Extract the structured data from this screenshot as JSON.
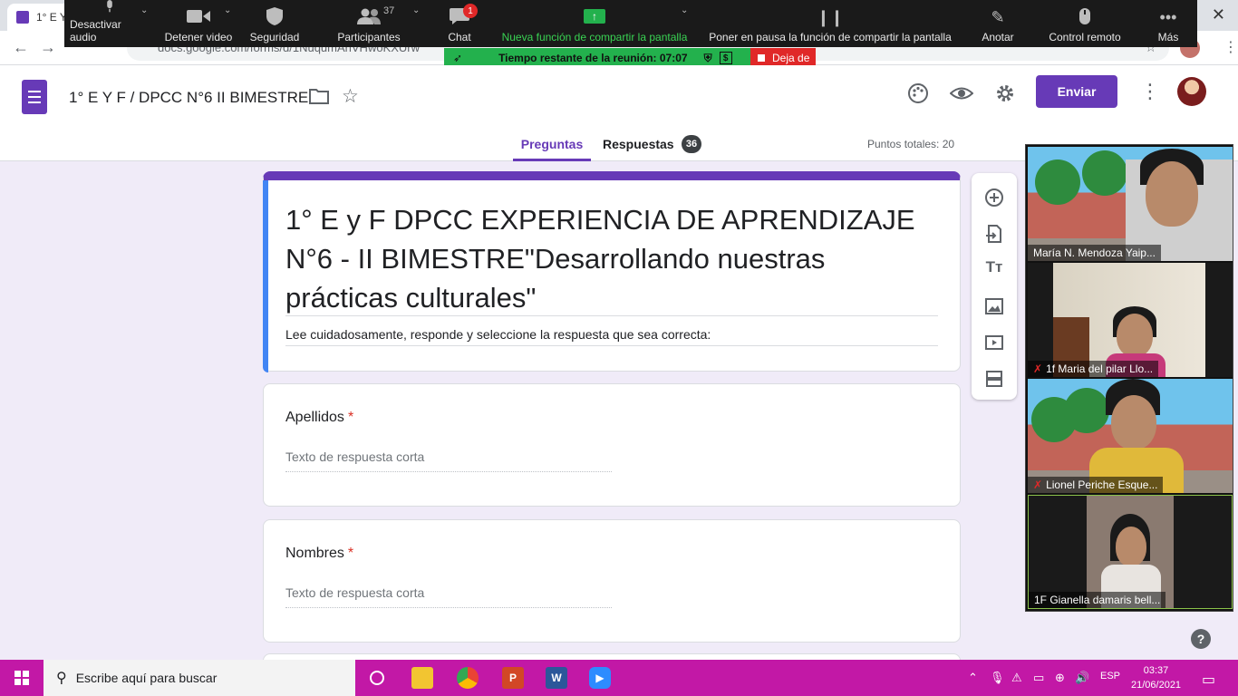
{
  "browser": {
    "tab_title": "1° E Y",
    "url": "docs.google.com/forms/d/1NuqumAhVHwoKXUrw"
  },
  "zoom": {
    "items": [
      {
        "label": "Desactivar audio",
        "icon": "microphone-icon"
      },
      {
        "label": "Detener video",
        "icon": "video-camera-icon"
      },
      {
        "label": "Seguridad",
        "icon": "shield-icon"
      },
      {
        "label": "Participantes",
        "icon": "participants-icon",
        "count": "37"
      },
      {
        "label": "Chat",
        "icon": "chat-icon",
        "badge": "1"
      },
      {
        "label": "Nueva función de compartir la pantalla",
        "icon": "share-screen-icon"
      },
      {
        "label": "Poner en pausa la función de compartir la pantalla",
        "icon": "pause-icon"
      },
      {
        "label": "Anotar",
        "icon": "pencil-icon"
      },
      {
        "label": "Control remoto",
        "icon": "mouse-icon"
      },
      {
        "label": "Más",
        "icon": "more-icon"
      }
    ],
    "timer": "Tiempo restante de la reunión: 07:07",
    "stop_share": "Deja de"
  },
  "forms": {
    "doc_title": "1° E  Y F  / DPCC N°6 II BIMESTRE",
    "send_label": "Enviar",
    "tab_questions": "Preguntas",
    "tab_responses": "Respuestas",
    "responses_count": "36",
    "total_points": "Puntos totales: 20",
    "form_title": "1°  E y F DPCC EXPERIENCIA DE APRENDIZAJE N°6 - II BIMESTRE\"Desarrollando nuestras prácticas culturales\"",
    "form_description": "Lee cuidadosamente, responde y seleccione la respuesta que sea correcta:",
    "questions": [
      {
        "label": "Apellidos",
        "required": "*",
        "placeholder": "Texto de respuesta corta"
      },
      {
        "label": "Nombres",
        "required": "*",
        "placeholder": "Texto de respuesta corta"
      }
    ]
  },
  "participants": [
    {
      "name": "María N. Mendoza Yaip...",
      "muted": false
    },
    {
      "name": "1f Maria del pilar Llo...",
      "muted": true
    },
    {
      "name": "Lionel Periche Esque...",
      "muted": true
    },
    {
      "name": "1F Gianella damaris bell...",
      "muted": false
    }
  ],
  "taskbar": {
    "search_placeholder": "Escribe aquí para buscar",
    "language": "ESP",
    "time": "03:37",
    "date": "21/06/2021"
  },
  "colors": {
    "forms_purple": "#673ab7",
    "zoom_green": "#23b14d",
    "zoom_red": "#e02828",
    "taskbar_magenta": "#c218a6"
  }
}
